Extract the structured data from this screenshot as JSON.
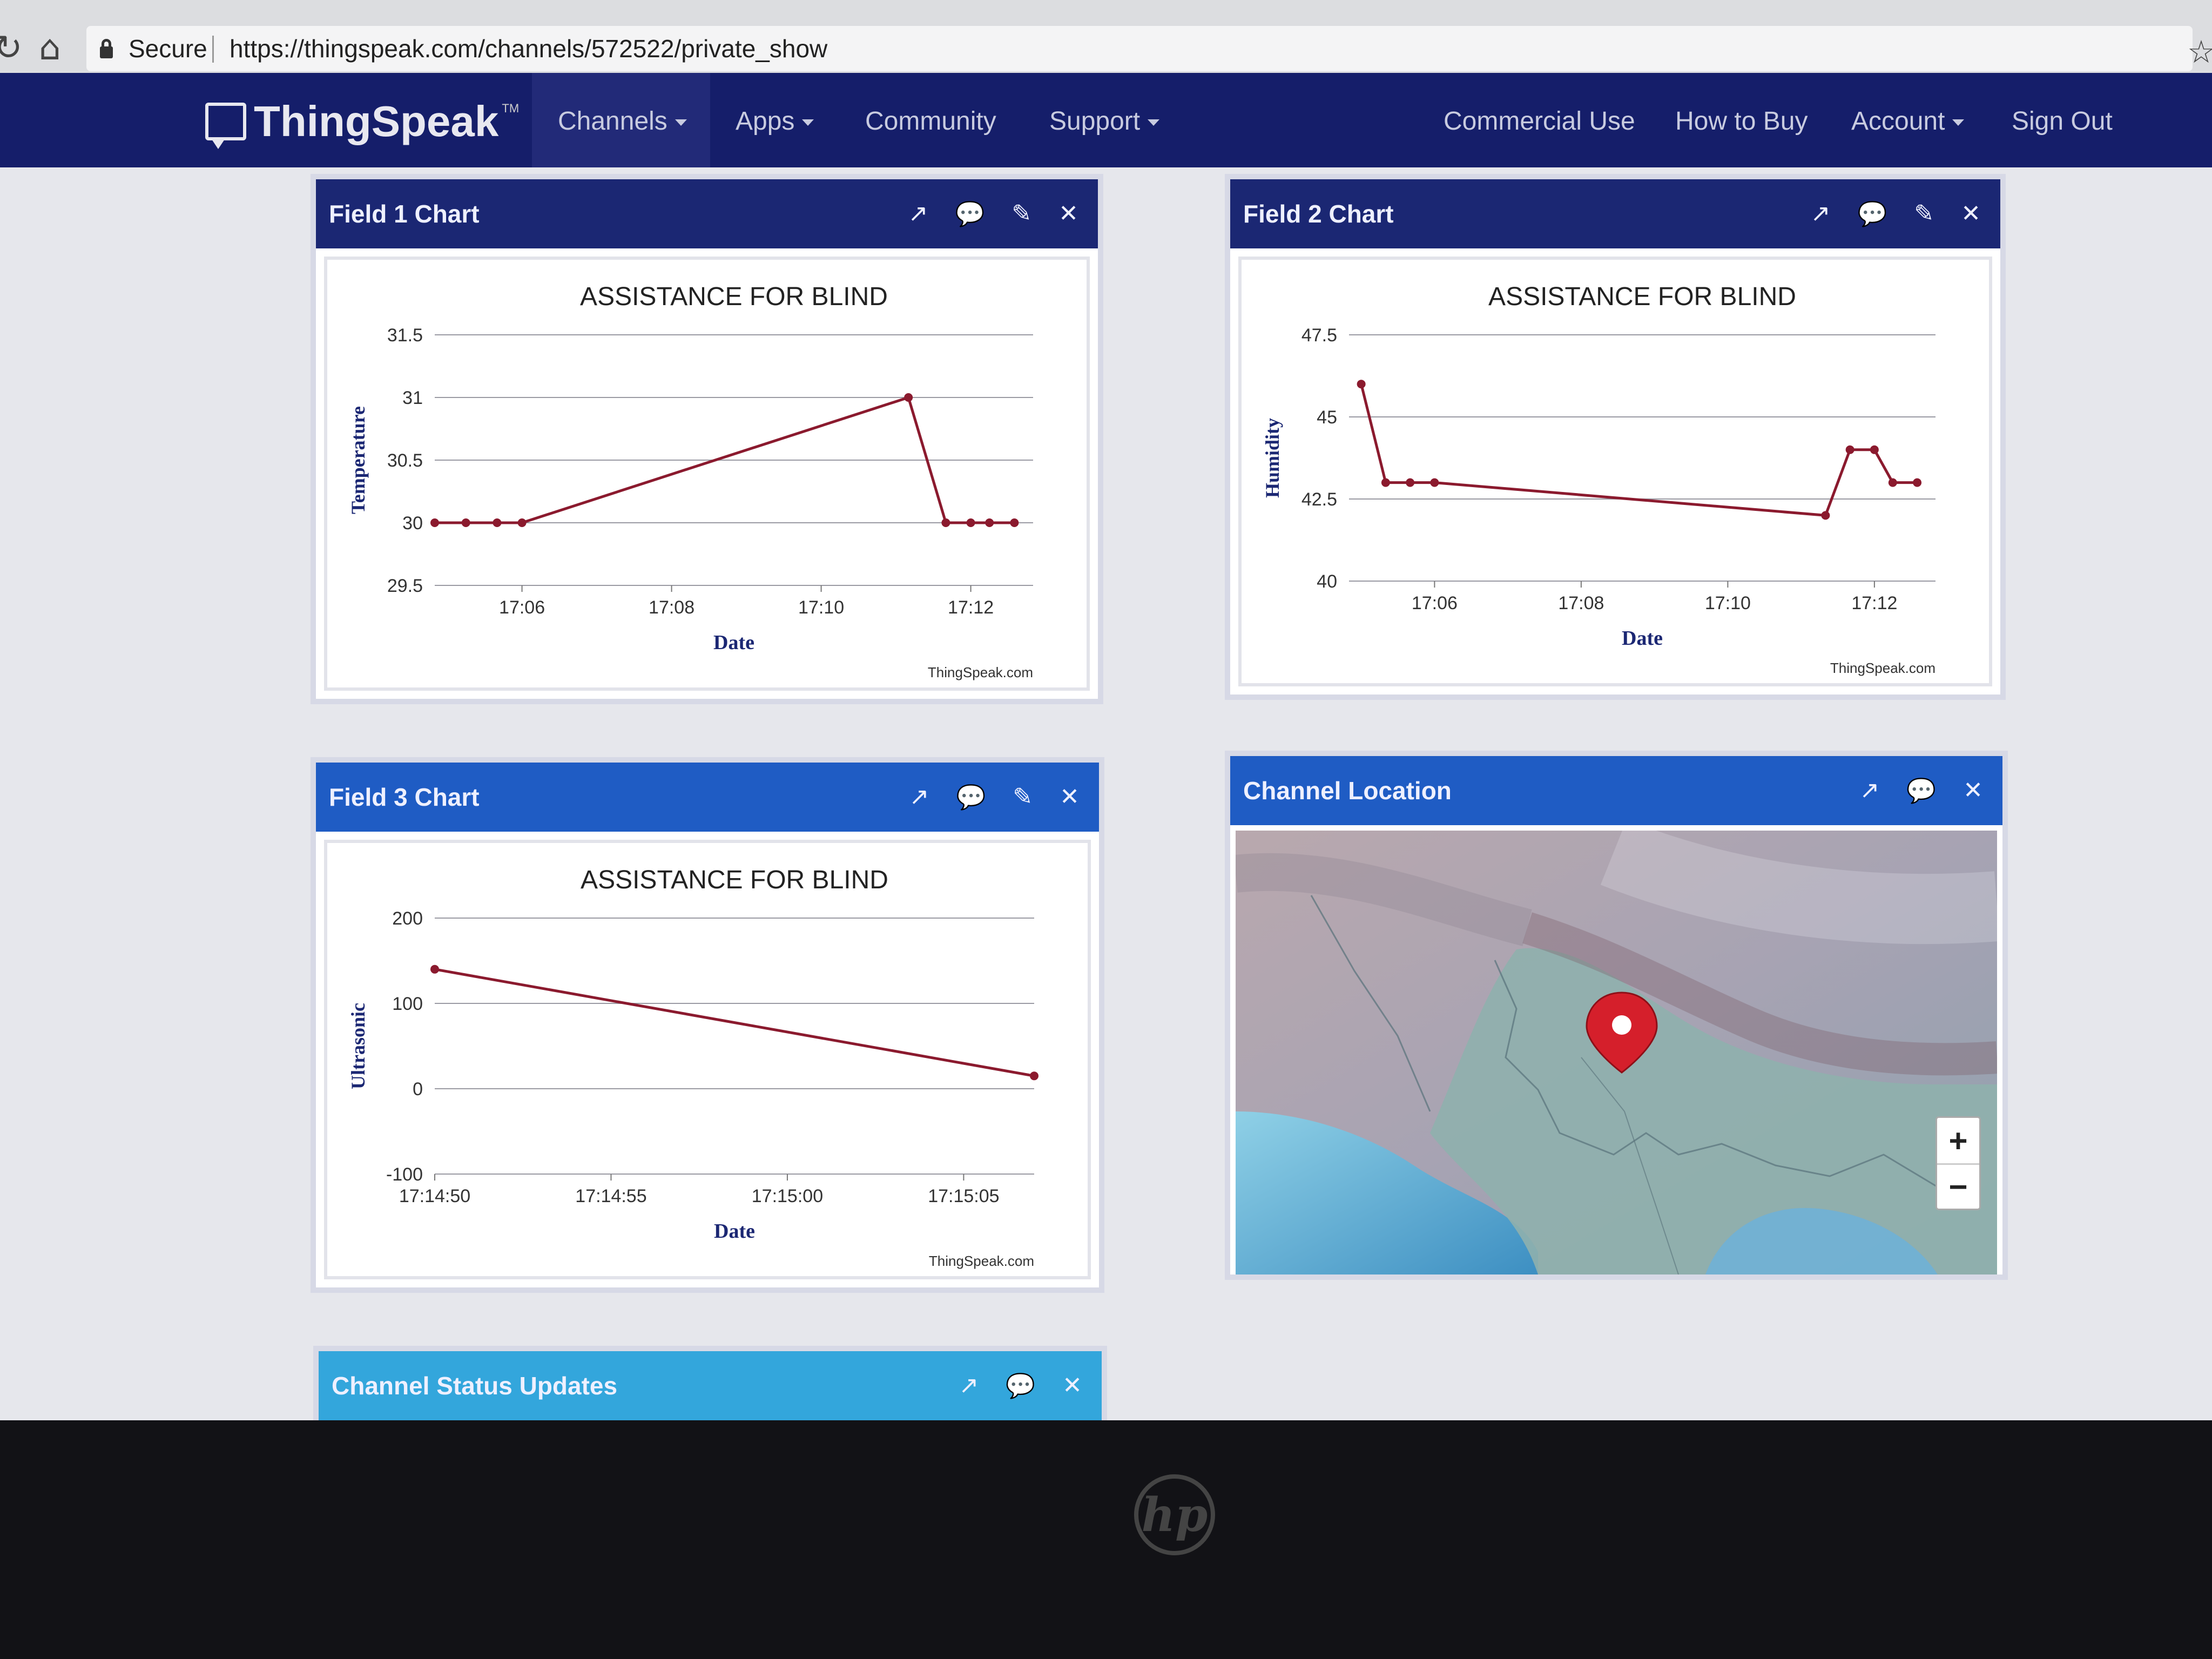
{
  "browser": {
    "secure_label": "Secure",
    "url": "https://thingspeak.com/channels/572522/private_show"
  },
  "nav": {
    "brand": "ThingSpeak",
    "trademark": "TM",
    "items": [
      "Channels",
      "Apps",
      "Community",
      "Support"
    ],
    "right_items": [
      "Commercial Use",
      "How to Buy",
      "Account",
      "Sign Out"
    ]
  },
  "panels": {
    "field1": {
      "title": "Field 1 Chart"
    },
    "field2": {
      "title": "Field 2 Chart"
    },
    "field3": {
      "title": "Field 3 Chart"
    },
    "location": {
      "title": "Channel Location"
    },
    "status": {
      "title": "Channel Status Updates"
    }
  },
  "map": {
    "zoom_in": "+",
    "zoom_out": "−"
  },
  "colors": {
    "navbar": "#151e6a",
    "series": "#8b1a2e",
    "panel_navy": "#1b2773",
    "panel_blue": "#1f5cc4",
    "panel_light": "#33a6dc"
  },
  "chart_data": [
    {
      "id": "field1",
      "type": "line",
      "title": "ASSISTANCE FOR BLIND",
      "xlabel": "Date",
      "ylabel": "Temperature",
      "credit": "ThingSpeak.com",
      "x_ticks": [
        "17:06",
        "17:08",
        "17:10",
        "17:12"
      ],
      "y_ticks": [
        "31.5",
        "31",
        "30.5",
        "30",
        "29.5"
      ],
      "xlim": [
        "17:04:50",
        "17:12:50"
      ],
      "ylim": [
        29.5,
        31.5
      ],
      "x": [
        "17:04:50",
        "17:05:15",
        "17:05:40",
        "17:06:00",
        "17:11:10",
        "17:11:40",
        "17:12:00",
        "17:12:15",
        "17:12:35"
      ],
      "y": [
        30.0,
        30.0,
        30.0,
        30.0,
        31.0,
        30.0,
        30.0,
        30.0,
        30.0
      ]
    },
    {
      "id": "field2",
      "type": "line",
      "title": "ASSISTANCE FOR BLIND",
      "xlabel": "Date",
      "ylabel": "Humidity",
      "credit": "ThingSpeak.com",
      "x_ticks": [
        "17:06",
        "17:08",
        "17:10",
        "17:12"
      ],
      "y_ticks": [
        "47.5",
        "45",
        "42.5",
        "40"
      ],
      "xlim": [
        "17:04:50",
        "17:12:50"
      ],
      "ylim": [
        40,
        47.5
      ],
      "x": [
        "17:05:00",
        "17:05:20",
        "17:05:40",
        "17:06:00",
        "17:11:20",
        "17:11:40",
        "17:12:00",
        "17:12:15",
        "17:12:35"
      ],
      "y": [
        46.0,
        43.0,
        43.0,
        43.0,
        42.0,
        44.0,
        44.0,
        43.0,
        43.0
      ]
    },
    {
      "id": "field3",
      "type": "line",
      "title": "ASSISTANCE FOR BLIND",
      "xlabel": "Date",
      "ylabel": "Ultrasonic",
      "credit": "ThingSpeak.com",
      "x_ticks": [
        "17:14:50",
        "17:14:55",
        "17:15:00",
        "17:15:05"
      ],
      "y_ticks": [
        "200",
        "100",
        "0",
        "-100"
      ],
      "xlim": [
        "17:14:50",
        "17:15:07"
      ],
      "ylim": [
        -100,
        200
      ],
      "x": [
        "17:14:50",
        "17:15:07"
      ],
      "y": [
        140,
        15
      ]
    }
  ]
}
